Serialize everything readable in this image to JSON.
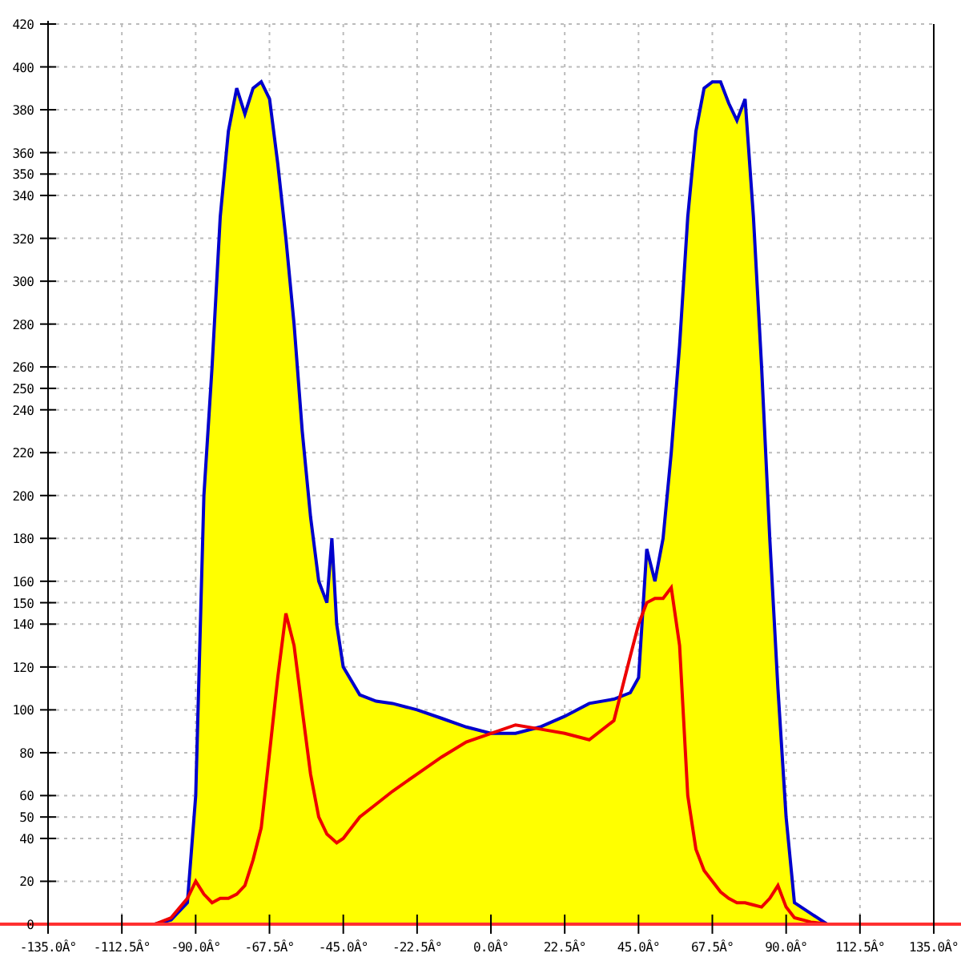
{
  "chart_data": {
    "type": "area",
    "x": [
      -102.5,
      -97.5,
      -92.5,
      -90,
      -87.5,
      -85,
      -82.5,
      -80,
      -77.5,
      -75,
      -72.5,
      -70,
      -67.5,
      -65,
      -62.5,
      -60,
      -57.5,
      -55,
      -52.5,
      -50,
      -48.5,
      -47,
      -45,
      -40,
      -35,
      -30,
      -22.5,
      -15,
      -7.5,
      0,
      7.5,
      15,
      22.5,
      30,
      37.5,
      42.5,
      45,
      47.5,
      50,
      52.5,
      55,
      57.5,
      60,
      62.5,
      65,
      67.5,
      70,
      72.5,
      75,
      77.5,
      80,
      82.5,
      85,
      87.5,
      90,
      92.5,
      97.5,
      102.5
    ],
    "series": [
      {
        "type": "area",
        "color": "#ffff00",
        "values": [
          0,
          2,
          10,
          60,
          200,
          260,
          330,
          370,
          390,
          378,
          390,
          393,
          385,
          355,
          320,
          280,
          230,
          190,
          160,
          150,
          180,
          140,
          120,
          107,
          104,
          103,
          100,
          96,
          92,
          89,
          89,
          92,
          97,
          103,
          105,
          108,
          115,
          175,
          160,
          180,
          220,
          270,
          330,
          370,
          390,
          393,
          393,
          383,
          375,
          385,
          330,
          260,
          180,
          110,
          50,
          10,
          5,
          0
        ]
      },
      {
        "type": "line",
        "color": "#ee0000",
        "values": [
          0,
          3,
          12,
          20,
          14,
          10,
          12,
          12,
          14,
          18,
          30,
          45,
          80,
          115,
          145,
          130,
          100,
          70,
          50,
          42,
          40,
          38,
          40,
          50,
          56,
          62,
          70,
          78,
          85,
          89,
          93,
          91,
          89,
          86,
          95,
          125,
          140,
          150,
          152,
          152,
          157,
          130,
          60,
          35,
          25,
          20,
          15,
          12,
          10,
          10,
          9,
          8,
          12,
          18,
          8,
          3,
          1,
          0
        ]
      }
    ],
    "grid": true,
    "xlim": [
      -135,
      135
    ],
    "ylim": [
      0,
      420
    ],
    "xticks": [
      {
        "value": -135,
        "label": "-135.0Â°"
      },
      {
        "value": -112.5,
        "label": "-112.5Â°"
      },
      {
        "value": -90,
        "label": "-90.0Â°"
      },
      {
        "value": -67.5,
        "label": "-67.5Â°"
      },
      {
        "value": -45,
        "label": "-45.0Â°"
      },
      {
        "value": -22.5,
        "label": "-22.5Â°"
      },
      {
        "value": 0,
        "label": "0.0Â°"
      },
      {
        "value": 22.5,
        "label": "22.5Â°"
      },
      {
        "value": 45,
        "label": "45.0Â°"
      },
      {
        "value": 67.5,
        "label": "67.5Â°"
      },
      {
        "value": 90,
        "label": "90.0Â°"
      },
      {
        "value": 112.5,
        "label": "112.5Â°"
      },
      {
        "value": 135,
        "label": "135.0Â°"
      }
    ],
    "yticks": [
      0,
      20,
      40,
      50,
      60,
      80,
      100,
      120,
      140,
      150,
      160,
      180,
      200,
      220,
      240,
      250,
      260,
      280,
      300,
      320,
      340,
      350,
      360,
      380,
      400,
      420
    ]
  }
}
